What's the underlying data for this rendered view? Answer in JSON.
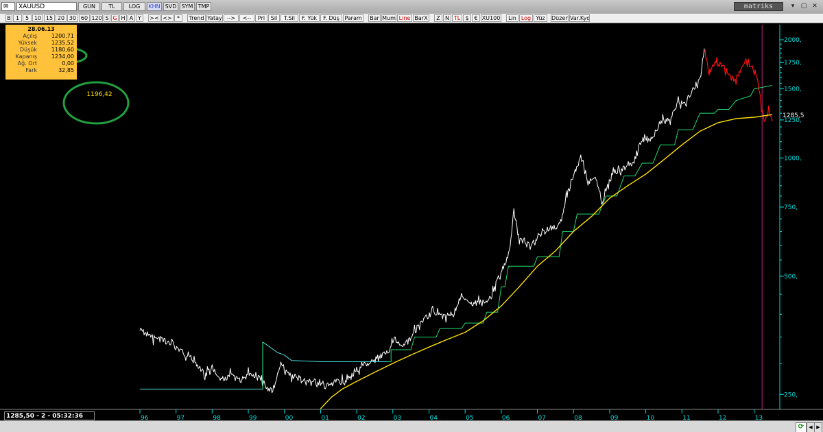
{
  "titlebar": {
    "symbol": "XAUUSD",
    "buttons": [
      {
        "label": "GUN",
        "selected": false
      },
      {
        "label": "TL",
        "selected": false
      },
      {
        "label": "LOG",
        "selected": false
      },
      {
        "label": "KHN",
        "selected": true
      },
      {
        "label": "SVD",
        "selected": false
      },
      {
        "label": "SYM",
        "selected": false
      },
      {
        "label": "TMP",
        "selected": false
      }
    ],
    "brand": "matriks",
    "window_controls": [
      "▾",
      "▢",
      "✕"
    ]
  },
  "toolbar": {
    "buttons": [
      {
        "label": "B",
        "red": false
      },
      {
        "label": "1",
        "red": false
      },
      {
        "label": "5",
        "red": false
      },
      {
        "label": "10",
        "red": false
      },
      {
        "label": "15",
        "red": false
      },
      {
        "label": "20",
        "red": false
      },
      {
        "label": "30",
        "red": false
      },
      {
        "label": "60",
        "red": false
      },
      {
        "label": "120",
        "red": false
      },
      {
        "label": "S",
        "red": false
      },
      {
        "label": "G",
        "red": true
      },
      {
        "label": "H",
        "red": false
      },
      {
        "label": "A",
        "red": false
      },
      {
        "label": "Y",
        "red": false
      },
      {
        "label": ">< ",
        "red": false
      },
      {
        "label": "<>",
        "red": false
      },
      {
        "label": "*",
        "red": false
      },
      {
        "label": "Trend",
        "red": false
      },
      {
        "label": "Yatay",
        "red": false
      },
      {
        "label": "-->",
        "red": false
      },
      {
        "label": "<--",
        "red": false
      },
      {
        "label": "Prl",
        "red": false
      },
      {
        "label": "Sil",
        "red": false
      },
      {
        "label": "T.Sil",
        "red": false
      },
      {
        "label": "F. Yük",
        "red": false
      },
      {
        "label": "F. Düş",
        "red": false
      },
      {
        "label": "Param",
        "red": false
      },
      {
        "label": "Bar",
        "red": false
      },
      {
        "label": "Mum",
        "red": false
      },
      {
        "label": "Line",
        "red": true
      },
      {
        "label": "BarX",
        "red": false
      },
      {
        "label": "Z",
        "red": false
      },
      {
        "label": "N",
        "red": false
      },
      {
        "label": "TL",
        "red": true
      },
      {
        "label": "$",
        "red": false
      },
      {
        "label": "€",
        "red": false
      },
      {
        "label": "XU100",
        "red": false
      },
      {
        "label": "Lin",
        "red": false
      },
      {
        "label": "Log",
        "red": true
      },
      {
        "label": "Yüz",
        "red": false
      },
      {
        "label": "Düzen",
        "red": false
      },
      {
        "label": "Var.Kyd",
        "red": false
      }
    ]
  },
  "info_panel": {
    "date": "28.06.13",
    "rows": [
      {
        "label": "Açılış",
        "value": "1200,71"
      },
      {
        "label": "Yüksek",
        "value": "1235,52"
      },
      {
        "label": "Düşük",
        "value": "1180,60"
      },
      {
        "label": "Kapanış",
        "value": "1234,00"
      },
      {
        "label": "Ağ. Ort",
        "value": "0,00"
      },
      {
        "label": "Fark",
        "value": "32,85"
      }
    ]
  },
  "annotation": {
    "text": "1196,42",
    "circle_color": "#22a040"
  },
  "status": {
    "readout": "1285,50 - 2 - 05:32:36",
    "refresh_icon": "refresh-icon"
  },
  "colors": {
    "price": "#ffffff",
    "price_recent": "#ff1010",
    "stop_line": "#20e070",
    "stop_line_early": "#50e0e0",
    "moving_avg": "#ffe000",
    "axis": "#00e0e0",
    "cursor_line": "#a0206a"
  },
  "chart_data": {
    "type": "line",
    "scale": "log",
    "ylim": [
      230,
      2150
    ],
    "y_ticks": [
      {
        "value": 2000,
        "label": "2000,"
      },
      {
        "value": 1750,
        "label": "1750,"
      },
      {
        "value": 1500,
        "label": "1500,"
      },
      {
        "value": 1250,
        "label": "1250,"
      },
      {
        "value": 1000,
        "label": "1000,"
      },
      {
        "value": 750,
        "label": "750,"
      },
      {
        "value": 500,
        "label": "500,"
      },
      {
        "value": 250,
        "label": "250,"
      }
    ],
    "last_value_label": {
      "value": 1285.5,
      "label": "1285,5"
    },
    "x_ticks": [
      "96",
      "97",
      "98",
      "99",
      "00",
      "01",
      "02",
      "03",
      "04",
      "05",
      "06",
      "07",
      "08",
      "09",
      "10",
      "11",
      "12",
      "13"
    ],
    "x_start_year": 1996,
    "x_end_year": 2013.5,
    "series": [
      {
        "role": "price",
        "points": [
          [
            1996.0,
            365
          ],
          [
            1996.3,
            350
          ],
          [
            1996.6,
            345
          ],
          [
            1996.9,
            335
          ],
          [
            1997.2,
            320
          ],
          [
            1997.5,
            305
          ],
          [
            1997.8,
            280
          ],
          [
            1998.0,
            290
          ],
          [
            1998.2,
            270
          ],
          [
            1998.5,
            280
          ],
          [
            1998.8,
            275
          ],
          [
            1999.0,
            285
          ],
          [
            1999.3,
            275
          ],
          [
            1999.5,
            260
          ],
          [
            1999.7,
            255
          ],
          [
            1999.9,
            300
          ],
          [
            2000.0,
            285
          ],
          [
            2000.2,
            280
          ],
          [
            2000.4,
            275
          ],
          [
            2000.6,
            270
          ],
          [
            2000.9,
            270
          ],
          [
            2001.0,
            265
          ],
          [
            2001.2,
            262
          ],
          [
            2001.4,
            268
          ],
          [
            2001.6,
            270
          ],
          [
            2001.8,
            275
          ],
          [
            2002.0,
            285
          ],
          [
            2002.3,
            300
          ],
          [
            2002.6,
            310
          ],
          [
            2002.9,
            320
          ],
          [
            2003.0,
            350
          ],
          [
            2003.3,
            330
          ],
          [
            2003.6,
            360
          ],
          [
            2003.9,
            390
          ],
          [
            2004.1,
            410
          ],
          [
            2004.4,
            395
          ],
          [
            2004.7,
            405
          ],
          [
            2004.9,
            440
          ],
          [
            2005.1,
            425
          ],
          [
            2005.4,
            430
          ],
          [
            2005.7,
            440
          ],
          [
            2005.9,
            490
          ],
          [
            2006.2,
            560
          ],
          [
            2006.35,
            720
          ],
          [
            2006.5,
            620
          ],
          [
            2006.8,
            600
          ],
          [
            2007.0,
            630
          ],
          [
            2007.3,
            660
          ],
          [
            2007.6,
            670
          ],
          [
            2007.8,
            790
          ],
          [
            2008.0,
            900
          ],
          [
            2008.2,
            1000
          ],
          [
            2008.4,
            870
          ],
          [
            2008.6,
            900
          ],
          [
            2008.8,
            760
          ],
          [
            2008.9,
            830
          ],
          [
            2009.1,
            920
          ],
          [
            2009.4,
            940
          ],
          [
            2009.7,
            1000
          ],
          [
            2009.9,
            1120
          ],
          [
            2010.1,
            1100
          ],
          [
            2010.4,
            1230
          ],
          [
            2010.7,
            1270
          ],
          [
            2010.9,
            1390
          ],
          [
            2011.1,
            1360
          ],
          [
            2011.3,
            1500
          ],
          [
            2011.5,
            1580
          ],
          [
            2011.62,
            1900
          ]
        ]
      },
      {
        "role": "price_recent",
        "points": [
          [
            2011.62,
            1900
          ],
          [
            2011.75,
            1650
          ],
          [
            2011.9,
            1750
          ],
          [
            2012.1,
            1720
          ],
          [
            2012.3,
            1600
          ],
          [
            2012.5,
            1600
          ],
          [
            2012.7,
            1740
          ],
          [
            2012.9,
            1720
          ],
          [
            2013.0,
            1670
          ],
          [
            2013.1,
            1580
          ],
          [
            2013.2,
            1360
          ],
          [
            2013.3,
            1240
          ],
          [
            2013.4,
            1340
          ],
          [
            2013.5,
            1240
          ]
        ]
      },
      {
        "role": "stop_line_early",
        "points": [
          [
            1996.0,
            258
          ],
          [
            1999.4,
            258
          ],
          [
            1999.4,
            340
          ],
          [
            1999.6,
            330
          ],
          [
            1999.8,
            320
          ],
          [
            2000.0,
            315
          ],
          [
            2000.2,
            305
          ],
          [
            2001.0,
            303
          ],
          [
            2002.85,
            303
          ]
        ]
      },
      {
        "role": "stop_line",
        "points": [
          [
            1999.4,
            258
          ],
          [
            1999.4,
            340
          ],
          [
            2002.85,
            303
          ],
          [
            2002.95,
            303
          ],
          [
            2002.95,
            325
          ],
          [
            2003.5,
            325
          ],
          [
            2003.6,
            350
          ],
          [
            2004.2,
            350
          ],
          [
            2004.3,
            368
          ],
          [
            2004.9,
            368
          ],
          [
            2005.0,
            380
          ],
          [
            2005.5,
            380
          ],
          [
            2005.6,
            405
          ],
          [
            2005.9,
            405
          ],
          [
            2006.0,
            470
          ],
          [
            2006.1,
            470
          ],
          [
            2006.2,
            530
          ],
          [
            2006.9,
            530
          ],
          [
            2007.0,
            560
          ],
          [
            2007.6,
            560
          ],
          [
            2007.7,
            650
          ],
          [
            2008.0,
            650
          ],
          [
            2008.1,
            720
          ],
          [
            2008.7,
            720
          ],
          [
            2008.9,
            800
          ],
          [
            2009.2,
            800
          ],
          [
            2009.4,
            900
          ],
          [
            2009.7,
            900
          ],
          [
            2009.9,
            970
          ],
          [
            2010.2,
            970
          ],
          [
            2010.4,
            1080
          ],
          [
            2010.8,
            1080
          ],
          [
            2010.9,
            1180
          ],
          [
            2011.3,
            1180
          ],
          [
            2011.5,
            1300
          ],
          [
            2011.9,
            1300
          ],
          [
            2012.0,
            1330
          ],
          [
            2012.3,
            1330
          ],
          [
            2012.5,
            1400
          ],
          [
            2012.9,
            1440
          ],
          [
            2013.0,
            1500
          ],
          [
            2013.5,
            1530
          ]
        ]
      },
      {
        "role": "moving_avg",
        "points": [
          [
            2001.0,
            230
          ],
          [
            2001.3,
            246
          ],
          [
            2001.6,
            258
          ],
          [
            2002.0,
            270
          ],
          [
            2002.5,
            285
          ],
          [
            2003.0,
            300
          ],
          [
            2003.5,
            315
          ],
          [
            2004.0,
            330
          ],
          [
            2004.5,
            345
          ],
          [
            2005.0,
            360
          ],
          [
            2005.5,
            385
          ],
          [
            2006.0,
            420
          ],
          [
            2006.5,
            470
          ],
          [
            2007.0,
            530
          ],
          [
            2007.5,
            580
          ],
          [
            2008.0,
            650
          ],
          [
            2008.5,
            710
          ],
          [
            2009.0,
            790
          ],
          [
            2009.5,
            850
          ],
          [
            2010.0,
            910
          ],
          [
            2010.5,
            990
          ],
          [
            2011.0,
            1080
          ],
          [
            2011.5,
            1170
          ],
          [
            2012.0,
            1230
          ],
          [
            2012.5,
            1260
          ],
          [
            2013.0,
            1270
          ],
          [
            2013.5,
            1290
          ]
        ]
      }
    ],
    "cursor_x": 2013.22
  }
}
